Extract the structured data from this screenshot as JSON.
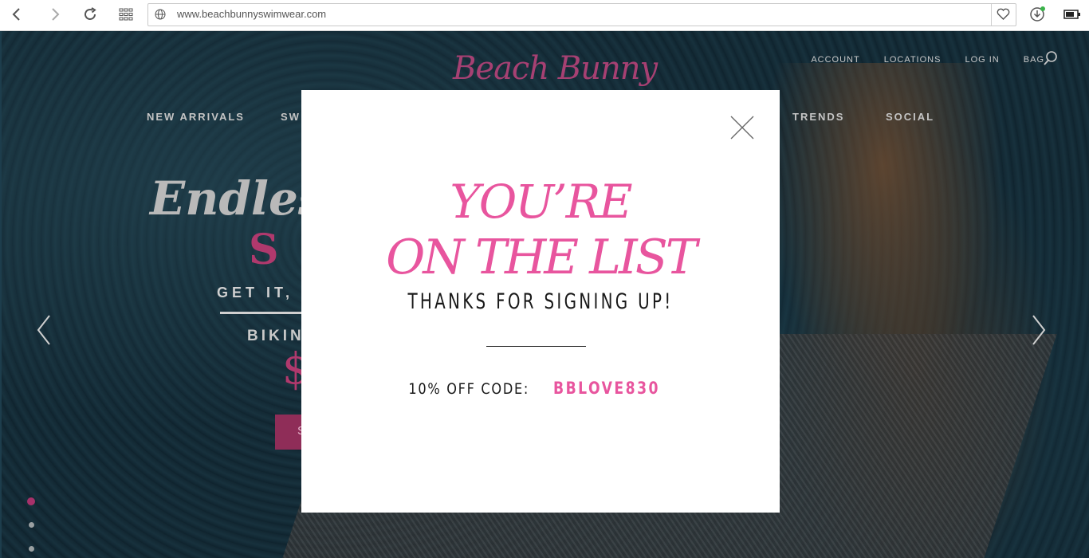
{
  "browser": {
    "url": "www.beachbunnyswimwear.com",
    "icons": [
      "back-icon",
      "forward-icon",
      "reload-icon",
      "apps-grid-icon",
      "globe-icon",
      "heart-icon",
      "download-icon",
      "battery-icon"
    ]
  },
  "site": {
    "logo": "Beach Bunny",
    "top_links": [
      "ACCOUNT",
      "LOCATIONS",
      "LOG IN",
      "BAG"
    ],
    "nav": [
      "NEW ARRIVALS",
      "SW",
      "TRENDS",
      "SOCIAL"
    ]
  },
  "hero": {
    "title": "Endles",
    "sale": "S A",
    "sub": "GET IT, D",
    "bikini": "BIKIN",
    "price": "$",
    "button": "S"
  },
  "modal": {
    "line1": "YOU’RE",
    "line2": "ON THE LIST",
    "thanks": "THANKS FOR SIGNING UP!",
    "code_label": "10% OFF CODE:",
    "code_value": "BBLOVE830"
  },
  "colors": {
    "accent_pink": "#e8559e",
    "brand_magenta": "#b0396d"
  }
}
